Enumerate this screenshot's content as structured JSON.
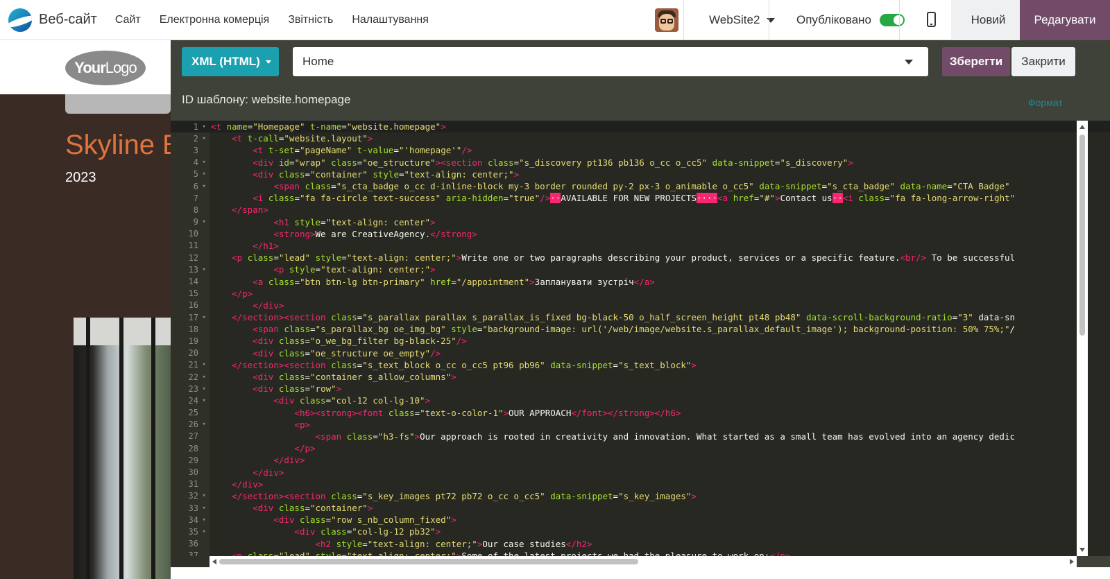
{
  "topbar": {
    "app_name": "Веб-сайт",
    "menu": [
      "Сайт",
      "Електронна комерція",
      "Звітність",
      "Налаштування"
    ],
    "website_selector": "WebSite2",
    "published_label": "Опубліковано",
    "published": true,
    "new_label": "Новий",
    "edit_label": "Редагувати"
  },
  "site_preview": {
    "logo_text_bold": "Your",
    "logo_text_light": "Logo",
    "heading": "Skyline Br",
    "year": "2023"
  },
  "editor": {
    "mode_label": "XML (HTML)",
    "view_selected": "Home",
    "save_label": "Зберегти",
    "close_label": "Закрити",
    "template_id": "ID шаблону: website.homepage",
    "format_label": "Формат",
    "lines": [
      {
        "n": "1",
        "fold": true,
        "text": "<t name=\"Homepage\" t-name=\"website.homepage\">"
      },
      {
        "n": "2",
        "fold": true,
        "text": "    <t t-call=\"website.layout\">"
      },
      {
        "n": "3",
        "fold": false,
        "text": "        <t t-set=\"pageName\" t-value=\"'homepage'\"/>"
      },
      {
        "n": "4",
        "fold": true,
        "text": "        <div id=\"wrap\" class=\"oe_structure\"><section class=\"s_discovery pt136 pb136 o_cc o_cc5\" data-snippet=\"s_discovery\">"
      },
      {
        "n": "5",
        "fold": true,
        "text": "        <div class=\"container\" style=\"text-align: center;\">"
      },
      {
        "n": "6",
        "fold": true,
        "text": "            <span class=\"s_cta_badge o_cc d-inline-block my-3 border rounded py-2 px-3 o_animable o_cc5\" data-snippet=\"s_cta_badge\" data-name=\"CTA Badge\""
      },
      {
        "n": "7",
        "fold": false,
        "text": "        <i class=\"fa fa-circle text-success\" aria-hidden=\"true\"/>··AVAILABLE FOR NEW PROJECTS····<a href=\"#\">Contact us··<i class=\"fa fa-long-arrow-right\""
      },
      {
        "n": "8",
        "fold": false,
        "text": "    </span>"
      },
      {
        "n": "9",
        "fold": true,
        "text": "            <h1 style=\"text-align: center\">"
      },
      {
        "n": "10",
        "fold": false,
        "text": "            <strong>We are CreativeAgency.</strong>"
      },
      {
        "n": "11",
        "fold": false,
        "text": "        </h1>"
      },
      {
        "n": "12",
        "fold": false,
        "text": "    <p class=\"lead\" style=\"text-align: center;\">Write one or two paragraphs describing your product, services or a specific feature.<br/> To be successful"
      },
      {
        "n": "13",
        "fold": true,
        "text": "            <p style=\"text-align: center;\">"
      },
      {
        "n": "14",
        "fold": false,
        "text": "        <a class=\"btn btn-lg btn-primary\" href=\"/appointment\">Запланувати зустріч</a>"
      },
      {
        "n": "15",
        "fold": false,
        "text": "    </p>"
      },
      {
        "n": "16",
        "fold": false,
        "text": "        </div>"
      },
      {
        "n": "17",
        "fold": true,
        "text": "    </section><section class=\"s_parallax parallax s_parallax_is_fixed bg-black-50 o_half_screen_height pt48 pb48\" data-scroll-background-ratio=\"3\" data-sn"
      },
      {
        "n": "18",
        "fold": false,
        "text": "        <span class=\"s_parallax_bg oe_img_bg\" style=\"background-image: url('/web/image/website.s_parallax_default_image'); background-position: 50% 75%;\"/"
      },
      {
        "n": "19",
        "fold": false,
        "text": "        <div class=\"o_we_bg_filter bg-black-25\"/>"
      },
      {
        "n": "20",
        "fold": false,
        "text": "        <div class=\"oe_structure oe_empty\"/>"
      },
      {
        "n": "21",
        "fold": true,
        "text": "    </section><section class=\"s_text_block o_cc o_cc5 pt96 pb96\" data-snippet=\"s_text_block\">"
      },
      {
        "n": "22",
        "fold": true,
        "text": "        <div class=\"container s_allow_columns\">"
      },
      {
        "n": "23",
        "fold": true,
        "text": "        <div class=\"row\">"
      },
      {
        "n": "24",
        "fold": true,
        "text": "            <div class=\"col-12 col-lg-10\">"
      },
      {
        "n": "25",
        "fold": false,
        "text": "                <h6><strong><font class=\"text-o-color-1\">OUR APPROACH</font></strong></h6>"
      },
      {
        "n": "26",
        "fold": true,
        "text": "                <p>"
      },
      {
        "n": "27",
        "fold": false,
        "text": "                    <span class=\"h3-fs\">Our approach is rooted in creativity and innovation. What started as a small team has evolved into an agency dedic"
      },
      {
        "n": "28",
        "fold": false,
        "text": "                </p>"
      },
      {
        "n": "29",
        "fold": false,
        "text": "            </div>"
      },
      {
        "n": "30",
        "fold": false,
        "text": "        </div>"
      },
      {
        "n": "31",
        "fold": false,
        "text": "    </div>"
      },
      {
        "n": "32",
        "fold": true,
        "text": "    </section><section class=\"s_key_images pt72 pb72 o_cc o_cc5\" data-snippet=\"s_key_images\">"
      },
      {
        "n": "33",
        "fold": true,
        "text": "        <div class=\"container\">"
      },
      {
        "n": "34",
        "fold": true,
        "text": "            <div class=\"row s_nb_column_fixed\">"
      },
      {
        "n": "35",
        "fold": true,
        "text": "                <div class=\"col-lg-12 pb32\">"
      },
      {
        "n": "36",
        "fold": false,
        "text": "                    <h2 style=\"text-align: center;\">Our case studies</h2>"
      },
      {
        "n": "37",
        "fold": false,
        "text": "    <p class=\"lead\" style=\"text-align: center;\">Some of the latest projects we had the pleasure to work on:</p>"
      }
    ]
  }
}
